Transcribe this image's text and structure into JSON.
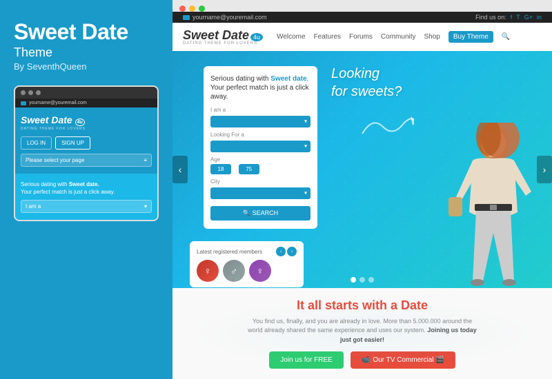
{
  "left": {
    "brand": "Sweet Date",
    "theme_label": "Theme",
    "by_label": "By SeventhQueen",
    "mobile": {
      "dots": [
        "dot1",
        "dot2",
        "dot3"
      ],
      "topbar_email": "yourname@youremail.com",
      "logo": "Sweet Date",
      "logo_suffix": "4u",
      "logo_sub": "DATING THEME FOR LOVERS",
      "btn_login": "LOG IN",
      "btn_signup": "SIGN UP",
      "dropdown_label": "Please select your page",
      "section2_text": "Serious dating with ",
      "section2_bold": "Sweet date.",
      "section2_text2": "Your perfect match is just a click away.",
      "iama_label": "I am a"
    }
  },
  "right": {
    "browser_dots": [
      "red",
      "yellow",
      "green"
    ],
    "topbar": {
      "email": "yourname@youremail.com",
      "find_us": "Find us on:",
      "socials": [
        "f",
        "T",
        "G+",
        "in"
      ]
    },
    "navbar": {
      "logo": "Sweet Date",
      "logo_suffix": "4u",
      "logo_sub": "DATING THEME FOR LOVERS",
      "nav_items": [
        "Welcome",
        "Features",
        "Forums",
        "Community",
        "Shop",
        "Buy Theme"
      ],
      "buy_theme": "Buy Theme"
    },
    "hero": {
      "tagline_line1": "Looking",
      "tagline_line2": "for sweets?",
      "form": {
        "title": "Serious dating with ",
        "title_bold": "Sweet date",
        "title_end": ". Your perfect match is just a click away.",
        "label_iama": "I am a",
        "label_looking": "Looking For a",
        "label_age": "Age",
        "age_from": "18",
        "age_to": "75",
        "label_city": "City",
        "search_btn": "SEARCH"
      },
      "members": {
        "title": "Latest registered members",
        "avatars": [
          "♀",
          "♂",
          "♀"
        ]
      }
    },
    "bottom": {
      "title_start": "It all starts with a ",
      "title_bold": "Date",
      "text": "You find us, finally, and you are already in love. More than 5.000.000 around the world already shared the same experience and uses our system.",
      "text_bold": "Joining us today just got easier!",
      "btn_free": "Join us for FREE",
      "btn_tv": "Our TV Commercial 🎬"
    },
    "slider_dots": [
      true,
      false,
      false
    ]
  }
}
